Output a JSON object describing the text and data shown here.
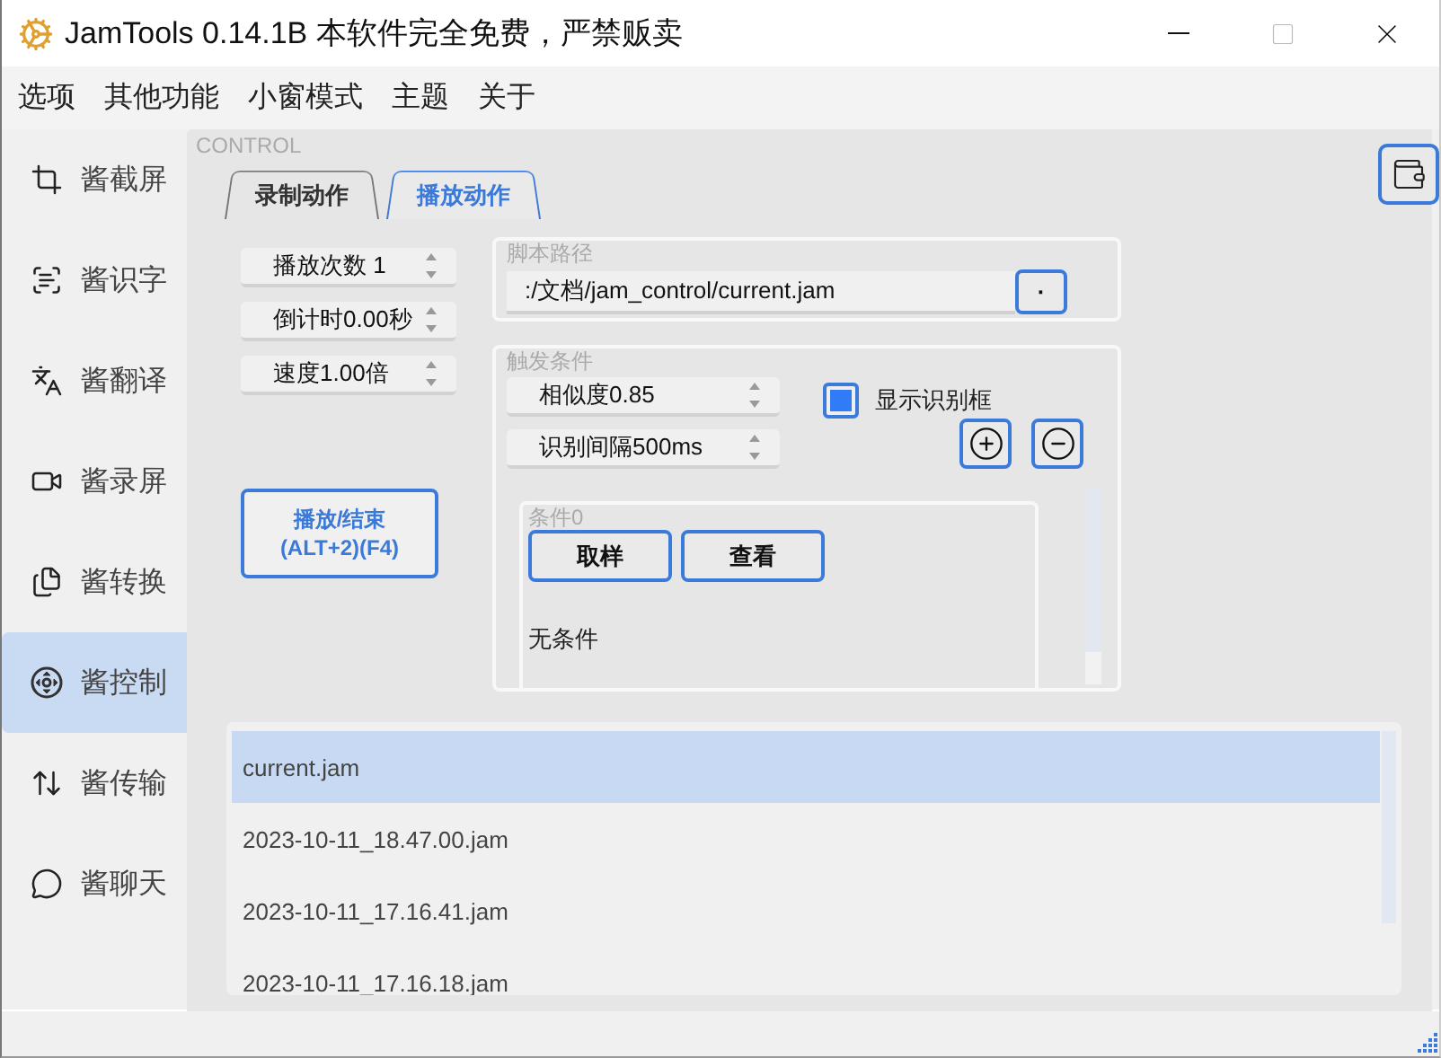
{
  "window": {
    "title": "JamTools 0.14.1B 本软件完全免费，严禁贩卖"
  },
  "menu": [
    "选项",
    "其他功能",
    "小窗模式",
    "主题",
    "关于"
  ],
  "sidebar": {
    "items": [
      {
        "label": "酱截屏",
        "selected": false
      },
      {
        "label": "酱识字",
        "selected": false
      },
      {
        "label": "酱翻译",
        "selected": false
      },
      {
        "label": "酱录屏",
        "selected": false
      },
      {
        "label": "酱转换",
        "selected": false
      },
      {
        "label": "酱控制",
        "selected": true
      },
      {
        "label": "酱传输",
        "selected": false
      },
      {
        "label": "酱聊天",
        "selected": false
      }
    ]
  },
  "panel": {
    "caption": "CONTROL",
    "tabs": [
      {
        "label": "录制动作",
        "selected": false
      },
      {
        "label": "播放动作",
        "selected": true
      }
    ]
  },
  "play_settings": [
    "播放次数 1",
    "倒计时0.00秒",
    "速度1.00倍"
  ],
  "play_button": [
    "播放/结束",
    "(ALT+2)(F4)"
  ],
  "script_path": {
    "title": "脚本路径",
    "value": ":/文档/jam_control/current.jam",
    "browse_button": "·"
  },
  "trigger": {
    "title": "触发条件",
    "settings": [
      "相似度0.85",
      "识别间隔500ms"
    ],
    "show_box": {
      "label": "显示识别框",
      "checked": true
    },
    "condition": {
      "title": "条件0",
      "buttons": [
        "取样",
        "查看"
      ],
      "text": "无条件"
    }
  },
  "files": [
    {
      "name": "current.jam",
      "selected": true
    },
    {
      "name": "2023-10-11_18.47.00.jam",
      "selected": false
    },
    {
      "name": "2023-10-11_17.16.41.jam",
      "selected": false
    },
    {
      "name": "2023-10-11_17.16.18.jam",
      "selected": false
    }
  ]
}
